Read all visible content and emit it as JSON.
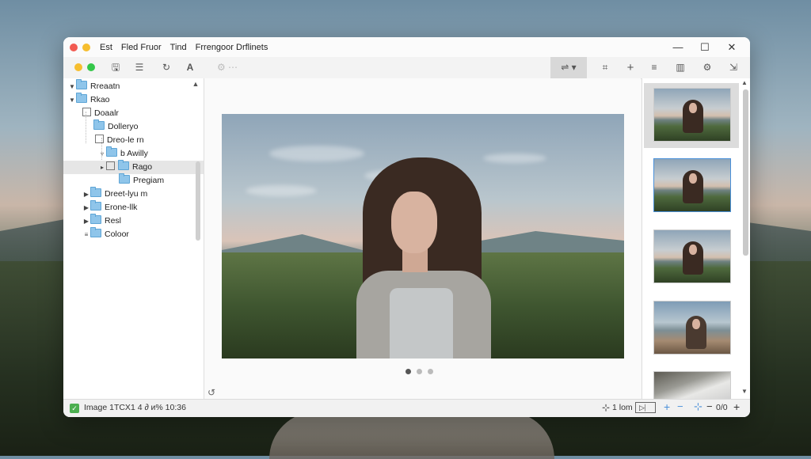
{
  "titlebar": {
    "menu": [
      "Est",
      "Fled Fruor",
      "Tind",
      "Frrengoor Drflinets"
    ],
    "minimize": "—",
    "maximize": "☐",
    "close": "✕"
  },
  "sidebar": {
    "items": [
      {
        "label": "Rreaatn"
      },
      {
        "label": "Rkao"
      },
      {
        "label": "Doaalr"
      },
      {
        "label": "Dolleryo"
      },
      {
        "label": "Dreo-le rn"
      },
      {
        "label": "b Awilly"
      },
      {
        "label": "Rago"
      },
      {
        "label": "Pregiam"
      },
      {
        "label": "Dreet-lyu m"
      },
      {
        "label": "Erone-llk"
      },
      {
        "label": "Resl"
      },
      {
        "label": "Coloor"
      }
    ]
  },
  "status": {
    "left": "Image 1ТСX1 4  ∂ и% 10:36",
    "zoom": "1 lom"
  },
  "colors": {
    "close_light": "#f25b52",
    "min_light": "#f6be2f",
    "max_light": "#34c749",
    "selection": "#4a90d9"
  }
}
